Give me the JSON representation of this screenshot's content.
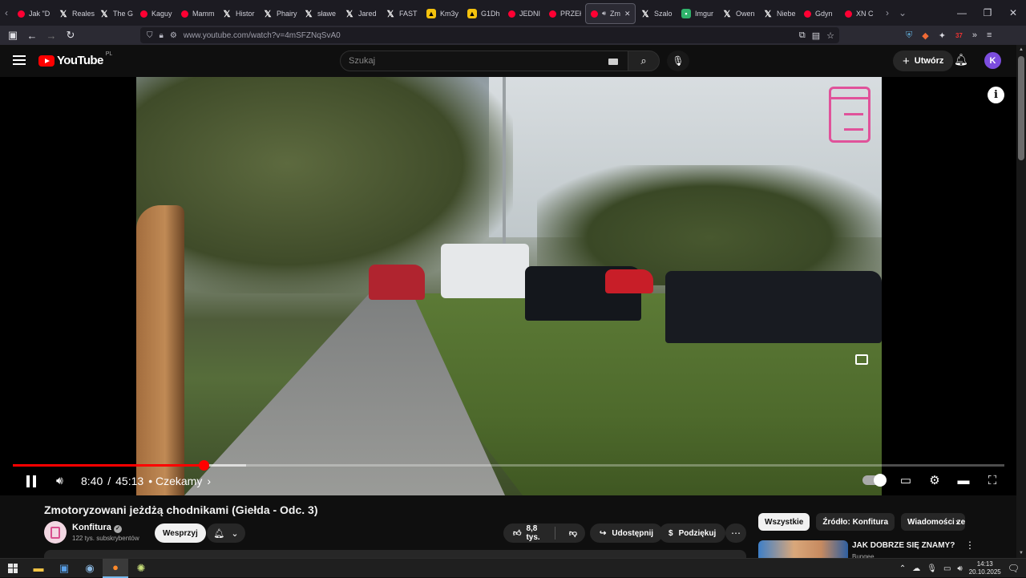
{
  "browser": {
    "tabs": [
      {
        "label": "Jak \"D",
        "icon": "youtube-icon"
      },
      {
        "label": "Realest",
        "icon": "x-icon"
      },
      {
        "label": "The G",
        "icon": "x-icon"
      },
      {
        "label": "Kaguy",
        "icon": "youtube-icon"
      },
      {
        "label": "Mamm",
        "icon": "youtube-icon"
      },
      {
        "label": "Histor",
        "icon": "x-icon"
      },
      {
        "label": "Phairy",
        "icon": "x-icon"
      },
      {
        "label": "sławe",
        "icon": "x-icon"
      },
      {
        "label": "Jared",
        "icon": "x-icon"
      },
      {
        "label": "FAST",
        "icon": "x-icon"
      },
      {
        "label": "Km3y",
        "icon": "km-icon"
      },
      {
        "label": "G1Dh",
        "icon": "km-icon"
      },
      {
        "label": "JEDNI",
        "icon": "youtube-icon"
      },
      {
        "label": "PRZEł",
        "icon": "youtube-icon"
      },
      {
        "label": "Zm",
        "icon": "youtube-icon",
        "active": true
      },
      {
        "label": "Szalo",
        "icon": "x-icon"
      },
      {
        "label": "Imgur",
        "icon": "imgur-icon"
      },
      {
        "label": "Owen",
        "icon": "x-icon"
      },
      {
        "label": "Niebe",
        "icon": "x-icon"
      },
      {
        "label": "Gdyn",
        "icon": "youtube-icon"
      },
      {
        "label": "XN C",
        "icon": "youtube-icon"
      }
    ],
    "url": "www.youtube.com/watch?v=4mSFZNqSvA0",
    "extension_badge": "37"
  },
  "youtube": {
    "logo_text": "YouTube",
    "country_code": "PL",
    "search_placeholder": "Szukaj",
    "create_label": "Utwórz",
    "avatar_letter": "K"
  },
  "player": {
    "current_time": "8:40",
    "separator": "/",
    "duration": "45:13",
    "chapter": "• Czekamy",
    "progress_fraction": 0.192,
    "buffered_fraction": 0.235
  },
  "video": {
    "title": "Zmotoryzowani jeżdżą chodnikami (Giełda - Odc. 3)",
    "channel_name": "Konfitura",
    "subscribers": "122 tys. subskrybentów",
    "support_label": "Wesprzyj",
    "likes": "8,8 tys.",
    "share_label": "Udostępnij",
    "thanks_label": "Podziękuj"
  },
  "sidebar": {
    "chips": [
      "Wszystkie",
      "Źródło: Konfitura",
      "Wiadomości ze"
    ],
    "rec_title": "JAK DOBRZE SIĘ ZNAMY?",
    "rec_channel": "Bungee"
  },
  "taskbar": {
    "time": "14:13",
    "date": "20.10.2025"
  }
}
